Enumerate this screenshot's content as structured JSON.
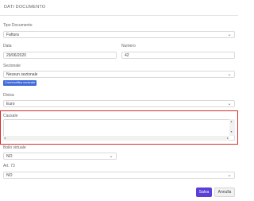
{
  "header": {
    "title": "DATI DOCUMENTO"
  },
  "form": {
    "tipo_documento": {
      "label": "Tipo Documento",
      "value": "Fattura"
    },
    "data": {
      "label": "Data",
      "value": "29/06/2020"
    },
    "numero": {
      "label": "Numero",
      "value": "42"
    },
    "sezionale": {
      "label": "Sezionale",
      "value": "Nessun sezionale",
      "button_label": "Crea/modifica sezionale"
    },
    "divisa": {
      "label": "Divisa",
      "value": "Euro"
    },
    "causale": {
      "label": "Causale",
      "value": ""
    },
    "bollo_virtuale": {
      "label": "Bollo virtuale",
      "value": "NO"
    },
    "art73": {
      "label": "Art. 73",
      "value": "NO"
    }
  },
  "actions": {
    "save_label": "Salva",
    "cancel_label": "Annulla"
  },
  "colors": {
    "highlight": "#d92c2c",
    "primary": "#5b3fd6",
    "sezionale_button": "#3f6ad8"
  }
}
